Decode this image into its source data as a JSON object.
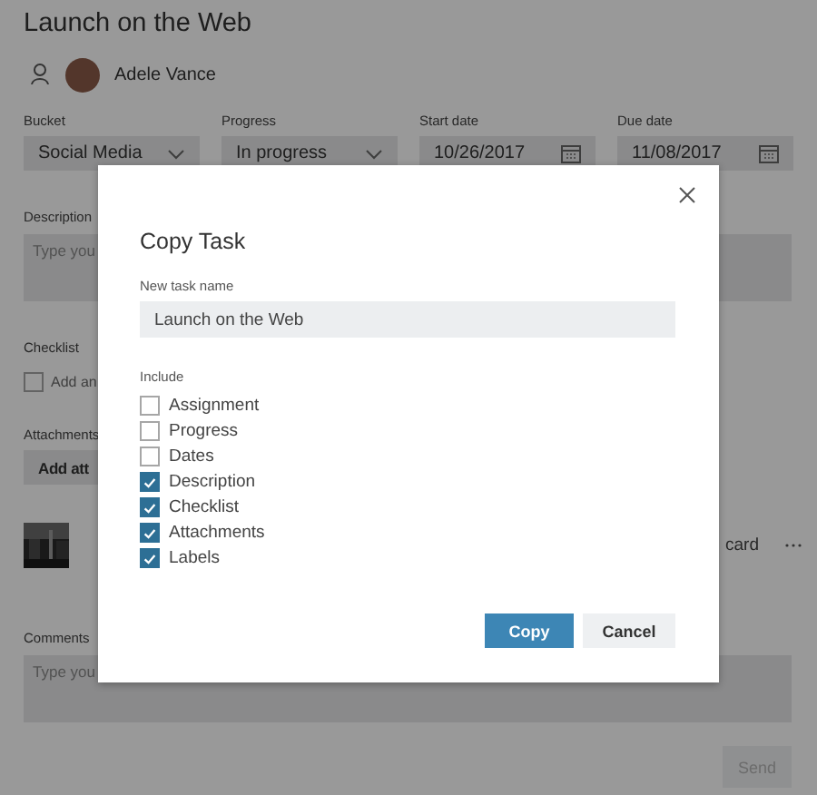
{
  "task_title": "Launch on the Web",
  "assignee": {
    "name": "Adele Vance"
  },
  "fields": [
    {
      "label": "Bucket",
      "value": "Social Media",
      "kind": "dropdown"
    },
    {
      "label": "Progress",
      "value": "In progress",
      "kind": "dropdown"
    },
    {
      "label": "Start date",
      "value": "10/26/2017",
      "kind": "date"
    },
    {
      "label": "Due date",
      "value": "11/08/2017",
      "kind": "date"
    }
  ],
  "description": {
    "label": "Description",
    "placeholder": "Type you"
  },
  "checklist": {
    "label": "Checklist",
    "placeholder": "Add an",
    "checked": false
  },
  "attachments": {
    "label": "Attachments",
    "button": "Add att",
    "items": [
      {
        "kind": "picture",
        "trailing_text": "card"
      }
    ]
  },
  "comments": {
    "label": "Comments",
    "placeholder": "Type you"
  },
  "send_button": {
    "label": "Send",
    "disabled": true
  },
  "dialog": {
    "title": "Copy Task",
    "name_label": "New task name",
    "name_value": "Launch on the Web",
    "include_label": "Include",
    "options": [
      {
        "label": "Assignment",
        "checked": false
      },
      {
        "label": "Progress",
        "checked": false
      },
      {
        "label": "Dates",
        "checked": false
      },
      {
        "label": "Description",
        "checked": true
      },
      {
        "label": "Checklist",
        "checked": true
      },
      {
        "label": "Attachments",
        "checked": true
      },
      {
        "label": "Labels",
        "checked": true
      }
    ],
    "buttons": [
      {
        "label": "Copy",
        "kind": "primary"
      },
      {
        "label": "Cancel",
        "kind": "secondary"
      }
    ]
  }
}
